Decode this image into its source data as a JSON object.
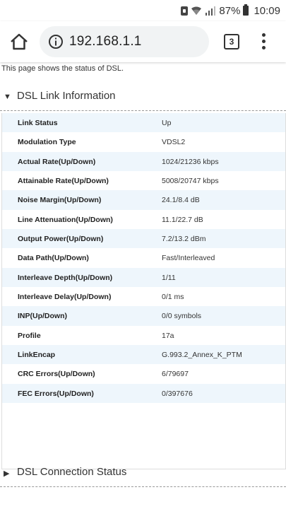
{
  "status_bar": {
    "battery_percent": "87%",
    "time": "10:09"
  },
  "browser": {
    "url": "192.168.1.1",
    "tab_count": "3"
  },
  "page": {
    "intro": "This page shows the status of DSL.",
    "section1": {
      "title": "DSL Link Information",
      "expanded": true
    },
    "section2": {
      "title": "DSL Connection Status",
      "expanded": false
    },
    "rows": [
      {
        "label": "Link Status",
        "value": "Up"
      },
      {
        "label": "Modulation Type",
        "value": "VDSL2"
      },
      {
        "label": "Actual Rate(Up/Down)",
        "value": "1024/21236 kbps"
      },
      {
        "label": "Attainable Rate(Up/Down)",
        "value": "5008/20747 kbps"
      },
      {
        "label": "Noise Margin(Up/Down)",
        "value": "24.1/8.4 dB"
      },
      {
        "label": "Line Attenuation(Up/Down)",
        "value": "11.1/22.7 dB"
      },
      {
        "label": "Output Power(Up/Down)",
        "value": "7.2/13.2 dBm"
      },
      {
        "label": "Data Path(Up/Down)",
        "value": "Fast/Interleaved"
      },
      {
        "label": "Interleave Depth(Up/Down)",
        "value": "1/11"
      },
      {
        "label": "Interleave Delay(Up/Down)",
        "value": "0/1 ms"
      },
      {
        "label": "INP(Up/Down)",
        "value": "0/0 symbols"
      },
      {
        "label": "Profile",
        "value": "17a"
      },
      {
        "label": "LinkEncap",
        "value": "G.993.2_Annex_K_PTM"
      },
      {
        "label": "CRC Errors(Up/Down)",
        "value": "6/79697"
      },
      {
        "label": "FEC Errors(Up/Down)",
        "value": "0/397676"
      }
    ]
  },
  "colors": {
    "row_shade": "#eef6fc",
    "urlbar_bg": "#f1f3f4"
  },
  "icons": [
    "sim-icon",
    "wifi-icon",
    "signal-icon",
    "battery-icon",
    "home-icon",
    "info-icon",
    "tabs-icon",
    "menu-icon",
    "triangle-down-icon",
    "triangle-right-icon"
  ]
}
